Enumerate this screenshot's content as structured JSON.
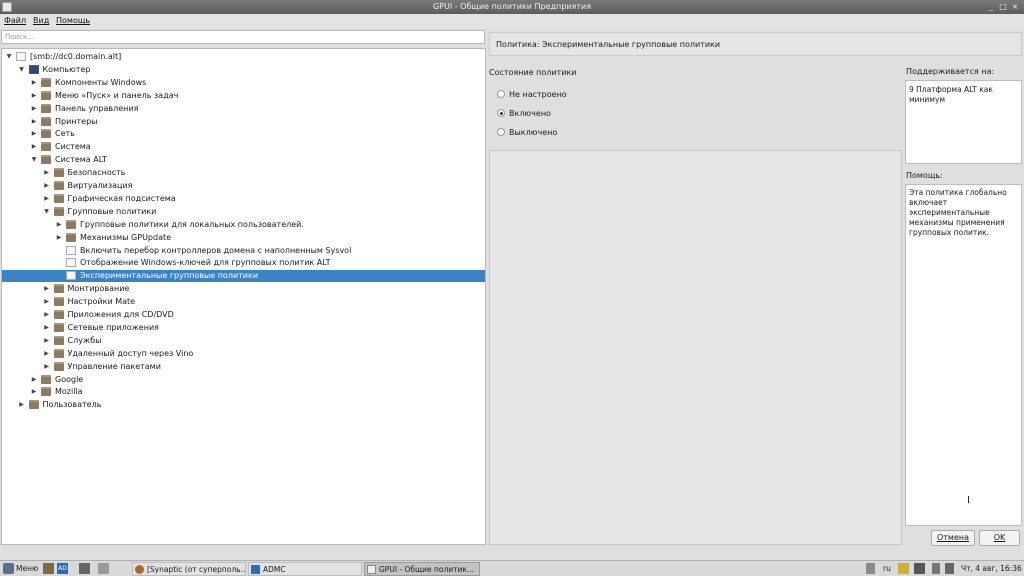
{
  "window": {
    "title": "GPUI - Общие политики Предприятия",
    "controls": {
      "minimize": "_",
      "maximize": "□",
      "close": "×"
    }
  },
  "menu": [
    "Файл",
    "Вид",
    "Помощь"
  ],
  "search": {
    "placeholder": "Поиск..."
  },
  "tree": [
    {
      "label": "[smb://dc0.domain.alt]",
      "level": 0,
      "icon": "document-icon",
      "expanded": true
    },
    {
      "label": "Компьютер",
      "level": 1,
      "icon": "computer-icon",
      "expanded": true
    },
    {
      "label": "Компоненты Windows",
      "level": 2,
      "icon": "folder-icon",
      "expanded": false
    },
    {
      "label": "Меню «Пуск» и панель задач",
      "level": 2,
      "icon": "folder-icon",
      "expanded": false
    },
    {
      "label": "Панель управления",
      "level": 2,
      "icon": "folder-icon",
      "expanded": false
    },
    {
      "label": "Принтеры",
      "level": 2,
      "icon": "folder-icon",
      "expanded": false
    },
    {
      "label": "Сеть",
      "level": 2,
      "icon": "folder-icon",
      "expanded": false
    },
    {
      "label": "Система",
      "level": 2,
      "icon": "folder-icon",
      "expanded": false
    },
    {
      "label": "Система ALT",
      "level": 2,
      "icon": "folder-icon",
      "expanded": true
    },
    {
      "label": "Безопасность",
      "level": 3,
      "icon": "folder-icon",
      "expanded": false
    },
    {
      "label": "Виртуализация",
      "level": 3,
      "icon": "folder-icon",
      "expanded": false
    },
    {
      "label": "Графическая подсистема",
      "level": 3,
      "icon": "folder-icon",
      "expanded": false
    },
    {
      "label": "Групповые политики",
      "level": 3,
      "icon": "folder-icon",
      "expanded": true
    },
    {
      "label": "Групповые политики для локальных пользователей.",
      "level": 4,
      "icon": "folder-icon",
      "expanded": false
    },
    {
      "label": "Механизмы GPUpdate",
      "level": 4,
      "icon": "folder-icon",
      "expanded": false
    },
    {
      "label": "Включить перебор контроллеров домена с наполненным Sysvol",
      "level": 4,
      "icon": "document-icon",
      "leaf": true
    },
    {
      "label": "Отображение Windows-ключей для групповых политик ALT",
      "level": 4,
      "icon": "document-icon",
      "leaf": true
    },
    {
      "label": "Экспериментальные групповые политики",
      "level": 4,
      "icon": "document-icon",
      "leaf": true,
      "selected": true
    },
    {
      "label": "Монтирование",
      "level": 3,
      "icon": "folder-icon",
      "expanded": false
    },
    {
      "label": "Настройки Mate",
      "level": 3,
      "icon": "folder-icon",
      "expanded": false
    },
    {
      "label": "Приложения для CD/DVD",
      "level": 3,
      "icon": "folder-icon",
      "expanded": false
    },
    {
      "label": "Сетевые приложения",
      "level": 3,
      "icon": "folder-icon",
      "expanded": false
    },
    {
      "label": "Службы",
      "level": 3,
      "icon": "folder-icon",
      "expanded": false
    },
    {
      "label": "Удаленный доступ через Vino",
      "level": 3,
      "icon": "folder-icon",
      "expanded": false
    },
    {
      "label": "Управление пакетами",
      "level": 3,
      "icon": "folder-icon",
      "expanded": false
    },
    {
      "label": "Google",
      "level": 2,
      "icon": "folder-icon",
      "expanded": false
    },
    {
      "label": "Mozilla",
      "level": 2,
      "icon": "folder-icon",
      "expanded": false
    },
    {
      "label": "Пользователь",
      "level": 1,
      "icon": "folder-icon",
      "expanded": false
    }
  ],
  "policy": {
    "title": "Политика: Экспериментальные групповые политики",
    "state_label": "Состояние политики",
    "options": [
      {
        "label": "Не настроено",
        "checked": false
      },
      {
        "label": "Включено",
        "checked": true
      },
      {
        "label": "Выключено",
        "checked": false
      }
    ],
    "supported_label": "Поддерживается на:",
    "supported_text": "9 Платформа ALT как минимум",
    "help_label": "Помощь:",
    "help_text": "Эта политика глобально включает экспериментальные механизмы применения групповых политик."
  },
  "buttons": {
    "cancel": "Отмена",
    "ok": "OK"
  },
  "taskbar": {
    "menu": "Меню",
    "tasks": [
      {
        "label": "[Synaptic (от суперполь...",
        "icon": "synaptic-icon",
        "active": false
      },
      {
        "label": "ADMC",
        "icon": "admc-icon",
        "active": false
      },
      {
        "label": "GPUI - Общие политик...",
        "icon": "gpui-icon",
        "active": true
      }
    ],
    "lang": "ru",
    "clock": "Чт, 4 авг, 16:36"
  }
}
